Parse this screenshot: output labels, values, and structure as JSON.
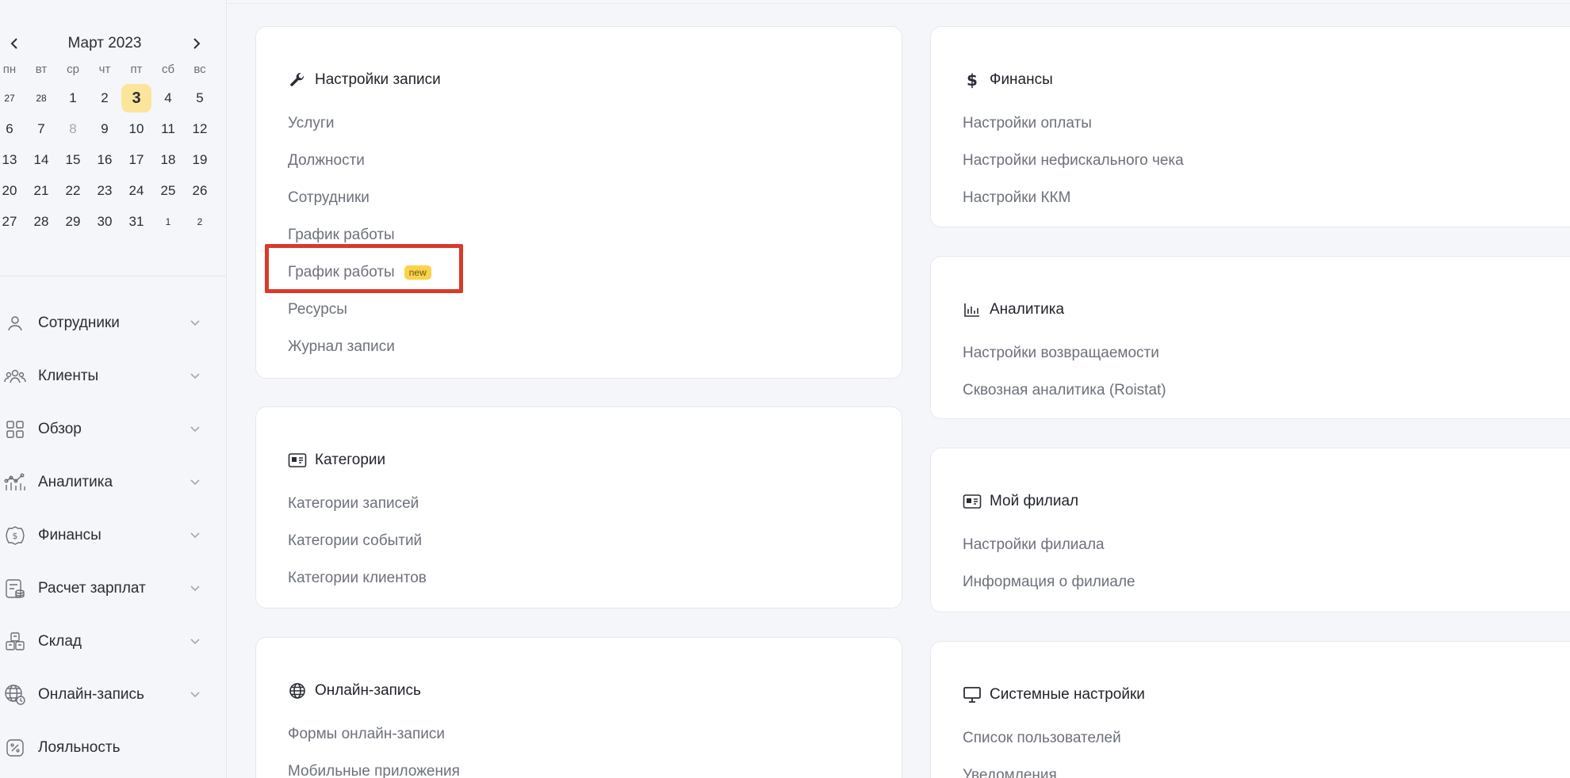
{
  "calendar": {
    "title": "Март 2023",
    "weekdays": [
      "пн",
      "вт",
      "ср",
      "чт",
      "пт",
      "сб",
      "вс"
    ],
    "weeks": [
      [
        "27",
        "28",
        "1",
        "2",
        "3",
        "4",
        "5"
      ],
      [
        "6",
        "7",
        "8",
        "9",
        "10",
        "11",
        "12"
      ],
      [
        "13",
        "14",
        "15",
        "16",
        "17",
        "18",
        "19"
      ],
      [
        "20",
        "21",
        "22",
        "23",
        "24",
        "25",
        "26"
      ],
      [
        "27",
        "28",
        "29",
        "30",
        "31",
        "1",
        "2"
      ]
    ],
    "selected_day": "3",
    "prev_icon": "chevron-left-icon",
    "next_icon": "chevron-right-icon"
  },
  "sidebar": {
    "items": [
      {
        "label": "Сотрудники",
        "icon": "user-icon"
      },
      {
        "label": "Клиенты",
        "icon": "clients-icon"
      },
      {
        "label": "Обзор",
        "icon": "grid-icon"
      },
      {
        "label": "Аналитика",
        "icon": "analytics-icon"
      },
      {
        "label": "Финансы",
        "icon": "finance-icon"
      },
      {
        "label": "Расчет зарплат",
        "icon": "payroll-icon"
      },
      {
        "label": "Склад",
        "icon": "warehouse-icon"
      },
      {
        "label": "Онлайн-запись",
        "icon": "online-booking-icon"
      },
      {
        "label": "Лояльность",
        "icon": "loyalty-icon"
      }
    ]
  },
  "cards": {
    "booking": {
      "title": "Настройки записи",
      "icon": "wrench-icon",
      "links": [
        "Услуги",
        "Должности",
        "Сотрудники",
        "График работы",
        "График работы",
        "Ресурсы",
        "Журнал записи"
      ],
      "badge": "new"
    },
    "categories": {
      "title": "Категории",
      "icon": "id-card-icon",
      "links": [
        "Категории записей",
        "Категории событий",
        "Категории клиентов"
      ]
    },
    "online": {
      "title": "Онлайн-запись",
      "icon": "globe-icon",
      "links": [
        "Формы онлайн-записи",
        "Мобильные приложения"
      ]
    },
    "finance": {
      "title": "Финансы",
      "icon": "dollar-icon",
      "links": [
        "Настройки оплаты",
        "Настройки нефискального чека",
        "Настройки ККМ"
      ]
    },
    "analytics": {
      "title": "Аналитика",
      "icon": "bar-chart-icon",
      "links": [
        "Настройки возвращаемости",
        "Сквозная аналитика (Roistat)"
      ]
    },
    "branch": {
      "title": "Мой филиал",
      "icon": "id-card-icon",
      "links": [
        "Настройки филиала",
        "Информация о филиале"
      ]
    },
    "system": {
      "title": "Системные настройки",
      "icon": "monitor-icon",
      "links": [
        "Список пользователей",
        "Уведомления"
      ]
    }
  },
  "colors": {
    "highlight": "#d93a2b",
    "today": "#fbe59a",
    "badge": "#fbd34a"
  }
}
